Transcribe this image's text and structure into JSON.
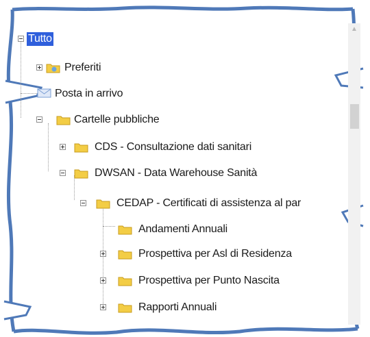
{
  "tree": {
    "root": {
      "label": "Tutto",
      "expander": "minus"
    },
    "items": [
      {
        "label": "Preferiti",
        "icon": "favorites-folder-icon",
        "expander": "plus"
      },
      {
        "label": "Posta in arrivo",
        "icon": "inbox-icon",
        "expander": "none"
      },
      {
        "label": "Cartelle pubbliche",
        "icon": "folder-icon",
        "expander": "minus"
      },
      {
        "label": "CDS - Consultazione dati sanitari",
        "icon": "folder-icon",
        "expander": "plus"
      },
      {
        "label": "DWSAN - Data Warehouse Sanità",
        "icon": "folder-icon",
        "expander": "minus"
      },
      {
        "label": "CEDAP - Certificati di assistenza al par",
        "icon": "folder-icon",
        "expander": "minus"
      },
      {
        "label": "Andamenti Annuali",
        "icon": "folder-icon",
        "expander": "none"
      },
      {
        "label": "Prospettiva per Asl di Residenza",
        "icon": "folder-icon",
        "expander": "plus"
      },
      {
        "label": "Prospettiva per Punto Nascita",
        "icon": "folder-icon",
        "expander": "plus"
      },
      {
        "label": "Rapporti Annuali",
        "icon": "folder-icon",
        "expander": "plus"
      }
    ]
  },
  "colors": {
    "selection": "#2f5fdc",
    "folder": "#f3cd45",
    "frame_edge": "#4f79b8"
  }
}
